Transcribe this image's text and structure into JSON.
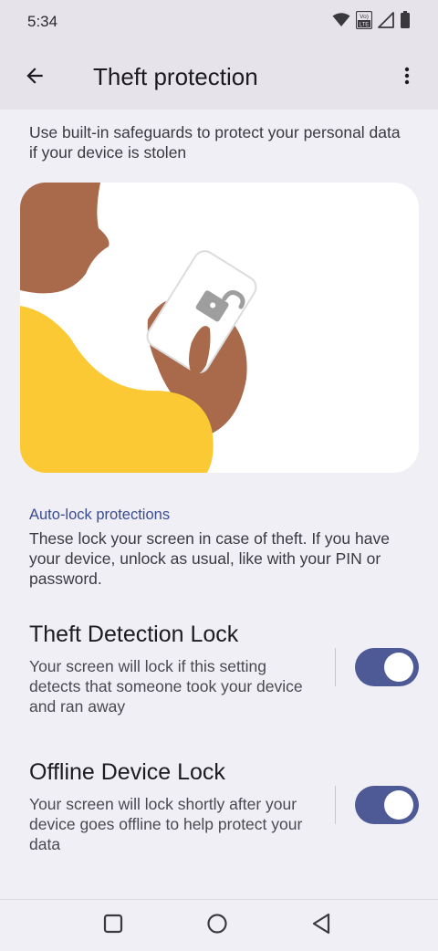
{
  "status_bar": {
    "time": "5:34",
    "icons": [
      "wifi-icon",
      "volte-icon",
      "signal-icon",
      "battery-icon"
    ],
    "volte_text_top": "Vo)",
    "volte_text_bottom": "LTE"
  },
  "app_bar": {
    "title": "Theft protection",
    "back_icon": "arrow-back-icon",
    "overflow_icon": "more-vert-icon"
  },
  "intro": {
    "text": "Use built-in safeguards to protect your personal data if your device is stolen"
  },
  "illustration": {
    "icon": "unlocked-padlock-icon"
  },
  "auto_lock": {
    "header": "Auto-lock protections",
    "description": "These lock your screen in case of theft. If you have your device, unlock as usual, like with your PIN or password."
  },
  "settings": [
    {
      "title": "Theft Detection Lock",
      "description": "Your screen will lock if this setting detects that someone took your device and ran away",
      "enabled": true
    },
    {
      "title": "Offline Device Lock",
      "description": "Your screen will lock shortly after your device goes offline to help protect your data",
      "enabled": true
    }
  ],
  "nav_bar": {
    "buttons": [
      "recents-icon",
      "home-icon",
      "back-triangle-icon"
    ]
  },
  "colors": {
    "accent": "#4e5a96",
    "section_header": "#3a4b8f",
    "background": "#f1eff6",
    "app_bar": "#e6e4ea",
    "illustration_yellow": "#fbc933",
    "illustration_skin": "#a9694b"
  }
}
